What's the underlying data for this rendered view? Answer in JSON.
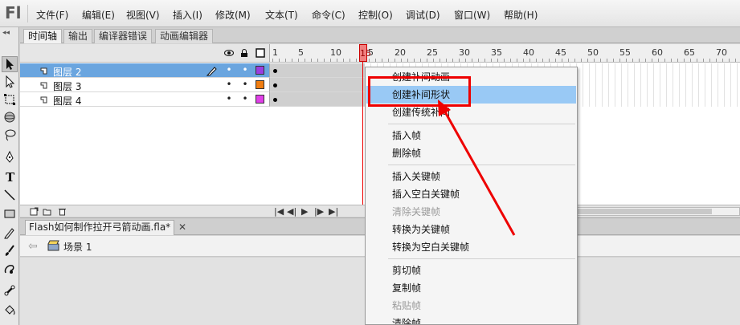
{
  "app": {
    "logo": "Fl"
  },
  "menubar": {
    "items": [
      "文件(F)",
      "编辑(E)",
      "视图(V)",
      "插入(I)",
      "修改(M)",
      "文本(T)",
      "命令(C)",
      "控制(O)",
      "调试(D)",
      "窗口(W)",
      "帮助(H)"
    ]
  },
  "toolbar": {
    "collapse_label": "◂◂",
    "tools": [
      "selection-tool-icon",
      "subselection-tool-icon",
      "free-transform-tool-icon",
      "3d-rotation-tool-icon",
      "lasso-tool-icon",
      "pen-tool-icon",
      "text-tool-icon",
      "line-tool-icon",
      "rectangle-tool-icon",
      "pencil-tool-icon",
      "brush-tool-icon",
      "deco-tool-icon",
      "bone-tool-icon",
      "paint-bucket-tool-icon"
    ]
  },
  "panel_tabs": [
    "时间轴",
    "输出",
    "编译器错误",
    "动画编辑器"
  ],
  "timeline": {
    "frame_numbers": [
      "1",
      "5",
      "10",
      "15",
      "20",
      "25",
      "30",
      "35",
      "40",
      "45",
      "50",
      "55",
      "60",
      "65",
      "70"
    ],
    "current_frame": "15",
    "layers": [
      {
        "name": "图层 2",
        "selected": true,
        "color": "#9b3ee0",
        "visible_dot": "•",
        "lock_dot": "•"
      },
      {
        "name": "图层 3",
        "selected": false,
        "color": "#f07d10",
        "visible_dot": "•",
        "lock_dot": "•"
      },
      {
        "name": "图层 4",
        "selected": false,
        "color": "#e040e8",
        "visible_dot": "•",
        "lock_dot": "•"
      }
    ],
    "playback_controls": [
      "|◀",
      "◀|",
      "▶",
      "|▶",
      "▶|"
    ]
  },
  "document": {
    "tab_title": "Flash如何制作拉开弓箭动画.fla*",
    "close": "✕",
    "back_arrow": "⇦",
    "scene": "场景 1"
  },
  "context_menu": {
    "items": [
      {
        "label": "创建补间动画",
        "disabled": false
      },
      {
        "label": "创建补间形状",
        "disabled": false,
        "hover": true
      },
      {
        "label": "创建传统补间",
        "disabled": false
      },
      {
        "sep": true
      },
      {
        "label": "插入帧",
        "disabled": false
      },
      {
        "label": "删除帧",
        "disabled": false
      },
      {
        "sep": true
      },
      {
        "label": "插入关键帧",
        "disabled": false
      },
      {
        "label": "插入空白关键帧",
        "disabled": false
      },
      {
        "label": "清除关键帧",
        "disabled": true
      },
      {
        "label": "转换为关键帧",
        "disabled": false
      },
      {
        "label": "转换为空白关键帧",
        "disabled": false
      },
      {
        "sep": true
      },
      {
        "label": "剪切帧",
        "disabled": false
      },
      {
        "label": "复制帧",
        "disabled": false
      },
      {
        "label": "粘贴帧",
        "disabled": true
      },
      {
        "label": "清除帧",
        "disabled": false
      }
    ]
  },
  "colors": {
    "selection_blue": "#6aa5df",
    "menu_hover": "#99c9f5",
    "annotation_red": "#e00000"
  }
}
